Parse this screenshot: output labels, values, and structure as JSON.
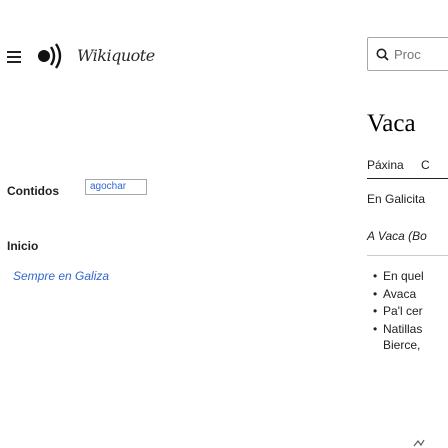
{
  "header": {
    "menu_icon": "hamburger-menu-icon",
    "logo_icon": "radio-waves-logo-icon",
    "logo_text": "Wikiquote",
    "search": {
      "placeholder": "Proc",
      "icon": "search-icon"
    }
  },
  "toc": {
    "title": "Contidos",
    "hide_label": "agochar",
    "items": [
      "Inicio",
      "Sempre en Galiza"
    ]
  },
  "article": {
    "title": "Vaca",
    "tabs": [
      "Páxina",
      "C"
    ],
    "intro": "En Galicita",
    "note": "A Vaca (Bo",
    "bullets": [
      "En quel",
      "Avaca",
      "Pa'l cer",
      "Natillas",
      "Bierce,"
    ]
  }
}
